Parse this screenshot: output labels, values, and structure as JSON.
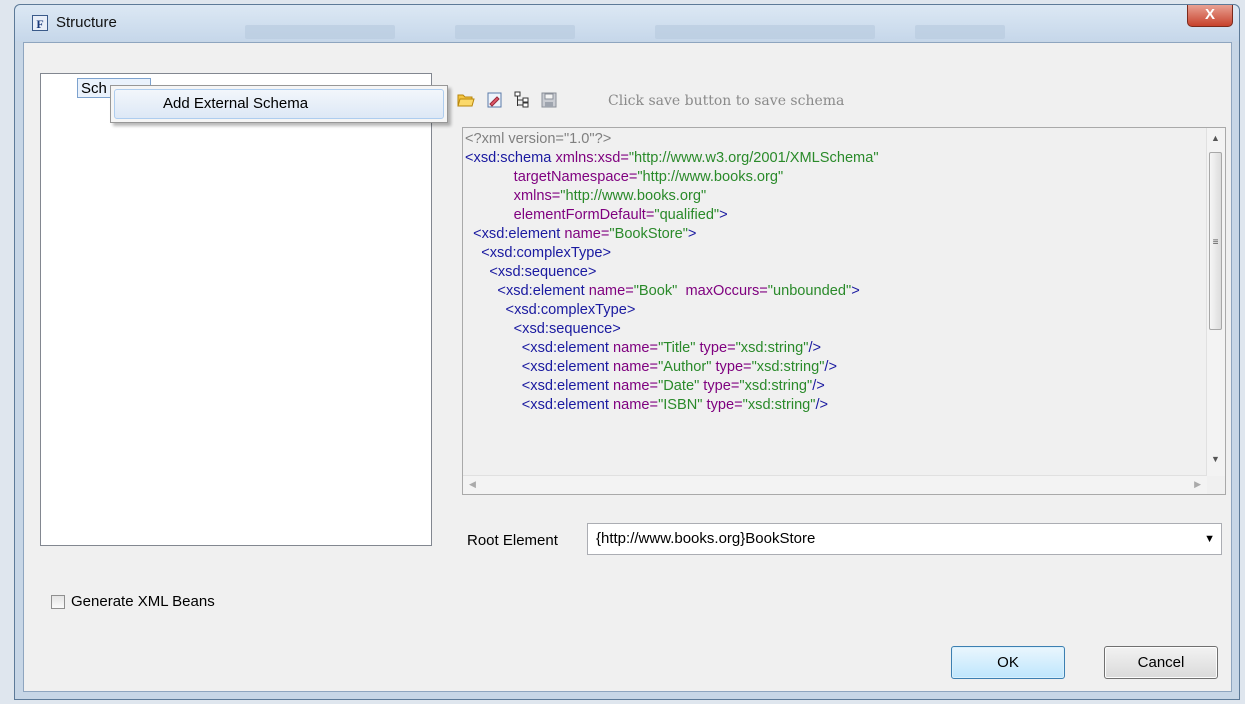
{
  "window": {
    "title": "Structure",
    "app_icon": "F",
    "close_glyph": "X"
  },
  "tree": {
    "node_label": "Sch"
  },
  "context_menu": {
    "items": [
      {
        "label": "Add External Schema"
      }
    ]
  },
  "toolbar": {
    "icons": [
      "open-folder-icon",
      "edit-document-icon",
      "tree-structure-icon",
      "save-disk-icon"
    ],
    "hint": "Click save button to save schema"
  },
  "editor": {
    "lines": [
      [
        [
          "decl",
          "<?xml version=\"1.0\"?>"
        ]
      ],
      [
        [
          "tag",
          "<xsd:schema "
        ],
        [
          "attr",
          "xmlns:xsd="
        ],
        [
          "val",
          "\"http://www.w3.org/2001/XMLSchema\""
        ]
      ],
      [
        [
          "tag",
          "            "
        ],
        [
          "attr",
          "targetNamespace="
        ],
        [
          "val",
          "\"http://www.books.org\""
        ]
      ],
      [
        [
          "tag",
          "            "
        ],
        [
          "attr",
          "xmlns="
        ],
        [
          "val",
          "\"http://www.books.org\""
        ]
      ],
      [
        [
          "tag",
          "            "
        ],
        [
          "attr",
          "elementFormDefault="
        ],
        [
          "val",
          "\"qualified\""
        ],
        [
          "tag",
          ">"
        ]
      ],
      [
        [
          "tag",
          "  <xsd:element "
        ],
        [
          "attr",
          "name="
        ],
        [
          "val",
          "\"BookStore\""
        ],
        [
          "tag",
          ">"
        ]
      ],
      [
        [
          "tag",
          "    <xsd:complexType>"
        ]
      ],
      [
        [
          "tag",
          "      <xsd:sequence>"
        ]
      ],
      [
        [
          "tag",
          "        <xsd:element "
        ],
        [
          "attr",
          "name="
        ],
        [
          "val",
          "\"Book\""
        ],
        [
          "attr",
          "  maxOccurs="
        ],
        [
          "val",
          "\"unbounded\""
        ],
        [
          "tag",
          ">"
        ]
      ],
      [
        [
          "tag",
          "          <xsd:complexType>"
        ]
      ],
      [
        [
          "tag",
          "            <xsd:sequence>"
        ]
      ],
      [
        [
          "tag",
          "              <xsd:element "
        ],
        [
          "attr",
          "name="
        ],
        [
          "val",
          "\"Title\""
        ],
        [
          "attr",
          " type="
        ],
        [
          "val",
          "\"xsd:string\""
        ],
        [
          "tag",
          "/>"
        ]
      ],
      [
        [
          "tag",
          "              <xsd:element "
        ],
        [
          "attr",
          "name="
        ],
        [
          "val",
          "\"Author\""
        ],
        [
          "attr",
          " type="
        ],
        [
          "val",
          "\"xsd:string\""
        ],
        [
          "tag",
          "/>"
        ]
      ],
      [
        [
          "tag",
          "              <xsd:element "
        ],
        [
          "attr",
          "name="
        ],
        [
          "val",
          "\"Date\""
        ],
        [
          "attr",
          " type="
        ],
        [
          "val",
          "\"xsd:string\""
        ],
        [
          "tag",
          "/>"
        ]
      ],
      [
        [
          "tag",
          "              <xsd:element "
        ],
        [
          "attr",
          "name="
        ],
        [
          "val",
          "\"ISBN\""
        ],
        [
          "attr",
          " type="
        ],
        [
          "val",
          "\"xsd:string\""
        ],
        [
          "tag",
          "/>"
        ]
      ]
    ],
    "scroll_icons": {
      "up": "▲",
      "down": "▼",
      "left": "◀",
      "right": "▶",
      "grip": "≡"
    }
  },
  "root_element": {
    "label": "Root Element",
    "value": "{http://www.books.org}BookStore",
    "arrow": "▼"
  },
  "generate_beans": {
    "label": "Generate XML Beans",
    "checked": false
  },
  "buttons": {
    "ok": "OK",
    "cancel": "Cancel"
  },
  "colors": {
    "tag": "#1a1aa0",
    "attribute": "#7f007f",
    "value": "#2a8a2a",
    "declaration": "#808080",
    "close_button": "#c7422c",
    "ok_border": "#3c7fb1"
  }
}
